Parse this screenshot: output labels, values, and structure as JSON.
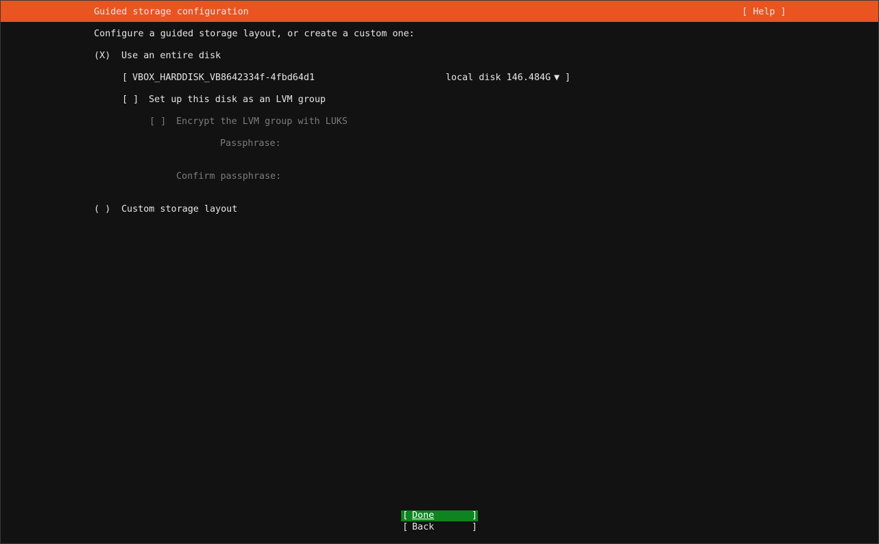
{
  "header": {
    "title": "Guided storage configuration",
    "help_label": "[ Help ]"
  },
  "intro": "Configure a guided storage layout, or create a custom one:",
  "use_entire_disk": {
    "radio": "(X)",
    "label": "Use an entire disk"
  },
  "disk_select": {
    "open_bracket": "[",
    "disk_name": "VBOX_HARDDISK_VB8642334f-4fbd64d1",
    "disk_info": "local disk 146.484G",
    "arrow": "▼",
    "close_bracket": "]"
  },
  "lvm": {
    "checkbox": "[ ]",
    "label": "Set up this disk as an LVM group"
  },
  "encrypt": {
    "checkbox": "[ ]",
    "label": "Encrypt the LVM group with LUKS"
  },
  "passphrase_label": "Passphrase:",
  "confirm_passphrase_label": "Confirm passphrase:",
  "custom_layout": {
    "radio": "( )",
    "label": "Custom storage layout"
  },
  "buttons": {
    "done_open": "[ ",
    "done_label": "Done",
    "done_close": "]",
    "back_open": "[ ",
    "back_label": "Back",
    "back_close": "]"
  },
  "colors": {
    "header_bg": "#e95420",
    "focused_button_bg": "#0e8420",
    "background": "#121212",
    "disabled_text": "#7c7c7c"
  }
}
